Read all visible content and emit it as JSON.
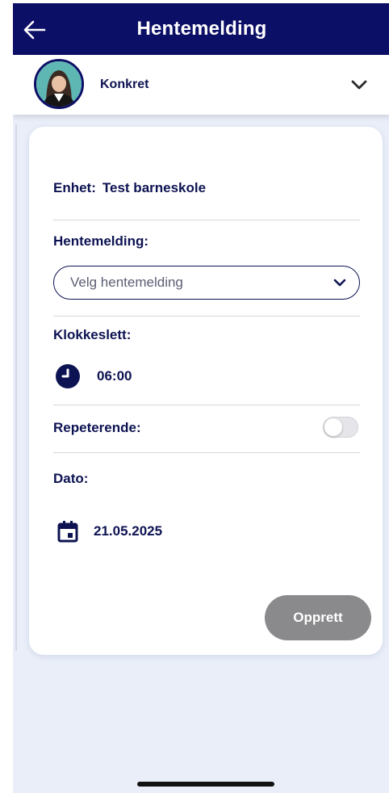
{
  "header": {
    "title": "Hentemelding",
    "back_icon": "arrow-left-icon"
  },
  "profile": {
    "name": "Konkret",
    "chevron_icon": "chevron-down-icon"
  },
  "form": {
    "enhet_label": "Enhet:",
    "enhet_value": "Test barneskole",
    "hentemelding_label": "Hentemelding:",
    "hentemelding_placeholder": "Velg hentemelding",
    "klokkeslett_label": "Klokkeslett:",
    "klokkeslett_value": "06:00",
    "repeterende_label": "Repeterende:",
    "repeterende_on": false,
    "dato_label": "Dato:",
    "dato_value": "21.05.2025",
    "create_label": "Opprett"
  },
  "colors": {
    "header": "#0c0f66",
    "accent": "#0d1352",
    "background": "#e9eef9",
    "button_disabled": "#8a8a8c"
  }
}
